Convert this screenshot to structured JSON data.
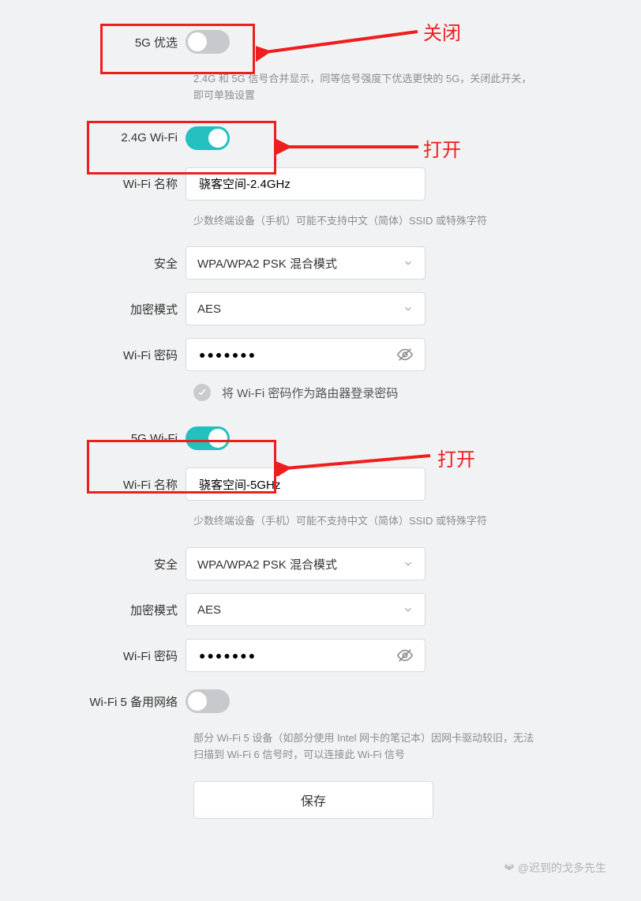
{
  "g5_prefer": {
    "label": "5G 优选",
    "on": false,
    "hint": "2.4G 和 5G 信号合并显示，同等信号强度下优选更快的 5G，关闭此开关，即可单独设置"
  },
  "wifi24": {
    "enable_label": "2.4G Wi-Fi",
    "on": true,
    "name_label": "Wi-Fi 名称",
    "name_value": "骁客空间-2.4GHz",
    "name_hint": "少数终端设备（手机）可能不支持中文（简体）SSID 或特殊字符",
    "security_label": "安全",
    "security_value": "WPA/WPA2 PSK 混合模式",
    "cipher_label": "加密模式",
    "cipher_value": "AES",
    "pwd_label": "Wi-Fi 密码",
    "pwd_value": "●●●●●●●"
  },
  "pwd_share": {
    "label": "将 Wi-Fi 密码作为路由器登录密码",
    "checked": false
  },
  "wifi5g": {
    "enable_label": "5G Wi-Fi",
    "on": true,
    "name_label": "Wi-Fi 名称",
    "name_value": "骁客空间-5GHz",
    "name_hint": "少数终端设备（手机）可能不支持中文（简体）SSID 或特殊字符",
    "security_label": "安全",
    "security_value": "WPA/WPA2 PSK 混合模式",
    "cipher_label": "加密模式",
    "cipher_value": "AES",
    "pwd_label": "Wi-Fi 密码",
    "pwd_value": "●●●●●●●"
  },
  "wifi5_backup": {
    "label": "Wi-Fi 5 备用网络",
    "on": false,
    "hint": "部分 Wi-Fi 5 设备（如部分使用 Intel 网卡的笔记本）因网卡驱动较旧，无法扫描到 Wi-Fi 6 信号时，可以连接此 Wi-Fi 信号"
  },
  "save_label": "保存",
  "annotations": {
    "close": "关闭",
    "open_1": "打开",
    "open_2": "打开"
  },
  "watermark": "@迟到的戈多先生"
}
